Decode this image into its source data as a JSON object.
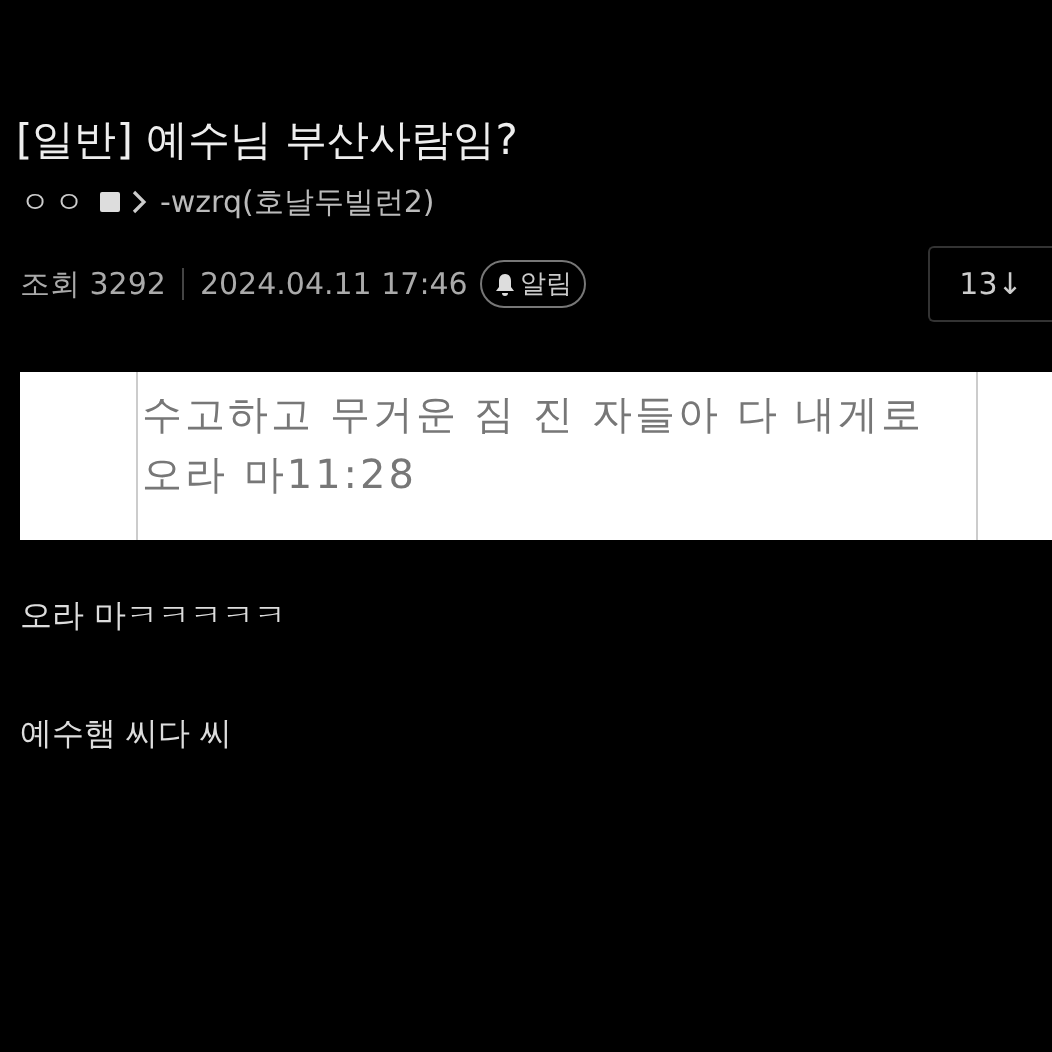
{
  "post": {
    "title": "[일반] 예수님 부산사람임?",
    "author": {
      "nickname": "ㅇㅇ",
      "id": "-wzrq(호날두빌런2)"
    },
    "views": "조회 3292",
    "date": "2024.04.11 17:46",
    "alert": "알림",
    "comment_count": "13↓"
  },
  "quote": {
    "text": "수고하고 무거운 짐 진 자들아 다 내게로 오라 마11:28"
  },
  "paragraphs": [
    "오라 마ㅋㅋㅋㅋㅋ",
    "예수햄 씨다 씨"
  ]
}
